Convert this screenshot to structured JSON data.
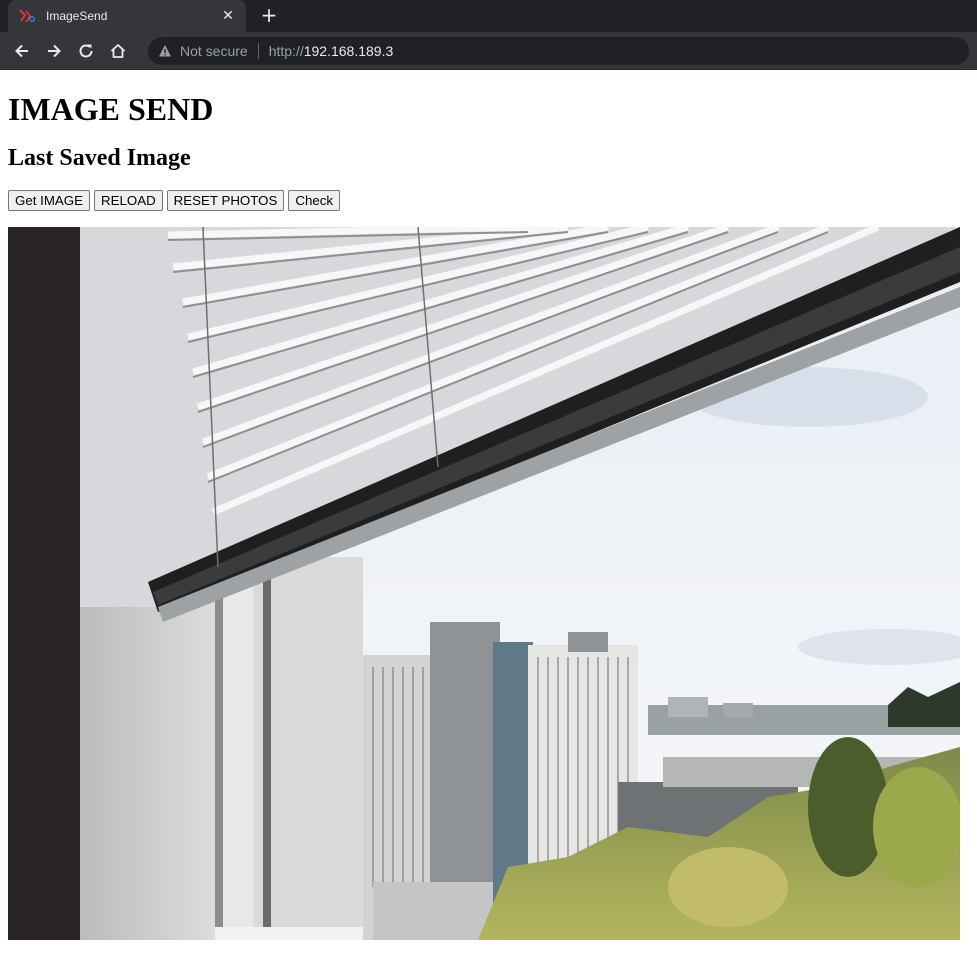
{
  "browser": {
    "tab_title": "ImageSend",
    "tab_close_glyph": "✕",
    "new_tab_glyph": "+",
    "security_label": "Not secure",
    "url_scheme": "http://",
    "url_host": "192.168.189.3",
    "icons": [
      "back-arrow-icon",
      "forward-arrow-icon",
      "reload-icon",
      "home-icon",
      "warning-triangle-icon"
    ]
  },
  "page": {
    "heading": "IMAGE SEND",
    "subheading": "Last Saved Image",
    "buttons": {
      "get_image": "Get IMAGE",
      "reload": "RELOAD",
      "reset_photos": "RESET PHOTOS",
      "check": "Check"
    }
  },
  "colors": {
    "chrome_dark": "#202124",
    "chrome_tab": "#35363a",
    "button_bg": "#efefef"
  }
}
